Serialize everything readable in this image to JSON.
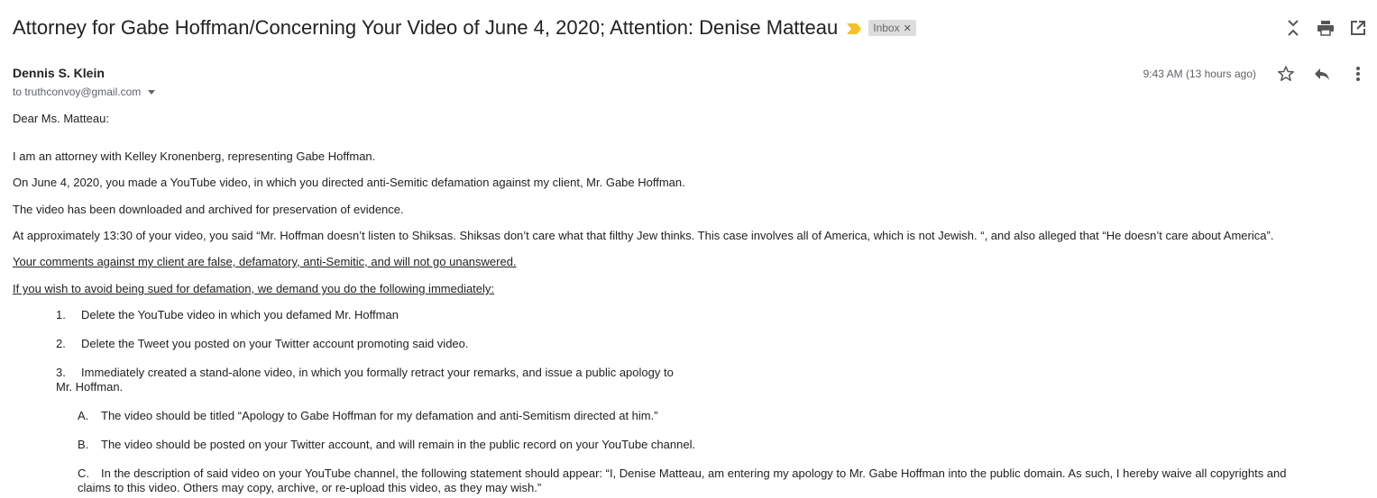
{
  "email": {
    "subject": "Attorney for Gabe Hoffman/Concerning Your Video of June 4, 2020; Attention: Denise Matteau",
    "label": "Inbox",
    "sender": "Dennis S. Klein",
    "to": "to truthconvoy@gmail.com",
    "time": "9:43 AM (13 hours ago)",
    "accent": "#f6c026"
  },
  "icons": [
    "collapse-all-icon",
    "print-icon",
    "open-in-new-window-icon",
    "star-icon",
    "reply-icon",
    "more-vert-icon",
    "importance-marker-icon"
  ],
  "body": {
    "greeting": "Dear Ms. Matteau:",
    "p1": "I am an attorney with Kelley Kronenberg, representing Gabe Hoffman.",
    "p2": "On June 4, 2020, you made a YouTube video, in which you directed anti-Semitic defamation against my client, Mr. Gabe Hoffman.",
    "p3": "The video has been downloaded and archived for preservation of evidence.",
    "p4": "At approximately 13:30 of your video, you said “Mr. Hoffman doesn’t listen to Shiksas.  Shiksas don’t care what that filthy Jew thinks.  This case involves all of America, which is not Jewish. “, and also alleged that “He doesn’t care about America”.",
    "p5": "Your comments against my client are false, defamatory, anti-Semitic, and will not go unanswered.",
    "p6": "If you wish to avoid being sued for defamation, we demand you do the following immediately:",
    "items": [
      {
        "num": "1.",
        "text": "Delete the YouTube video in which you defamed Mr. Hoffman"
      },
      {
        "num": "2.",
        "text": "Delete the Tweet you posted on your Twitter account promoting said video."
      },
      {
        "num": "3.",
        "text": "Immediately created a stand-alone video, in which you formally retract your remarks, and issue a public apology to",
        "cont": "Mr. Hoffman."
      }
    ],
    "subitems": [
      {
        "num": "A.",
        "text": "The video should be titled “Apology to Gabe Hoffman for my defamation and anti-Semitism directed at him.”"
      },
      {
        "num": "B.",
        "text": "The video should be posted on your Twitter account, and will remain in the public record on your YouTube channel."
      },
      {
        "num": "C.",
        "text": "In the description of said video on your YouTube channel, the following statement should appear: “I, Denise Matteau, am entering my apology to Mr. Gabe Hoffman into the public domain.  As such, I hereby waive all copyrights and",
        "cont": "claims to this video.  Others may copy, archive, or re-upload this video, as they may wish.”"
      }
    ]
  }
}
